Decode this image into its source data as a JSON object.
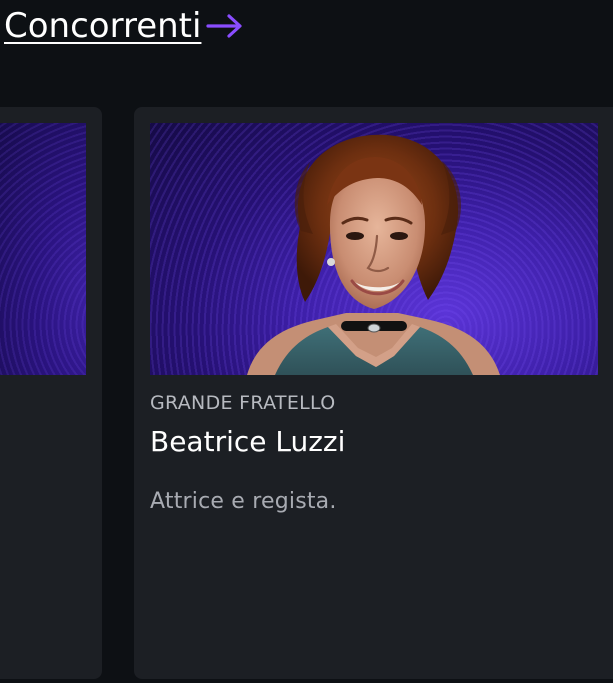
{
  "section": {
    "title": "Concorrenti",
    "arrow_icon": "arrow-right-icon",
    "accent_color": "#8a4dff"
  },
  "cards": [
    {
      "image_icon": "contestant-portrait-image"
    },
    {
      "kicker": "GRANDE FRATELLO",
      "name": "Beatrice Luzzi",
      "description": "Attrice e regista.",
      "image_icon": "contestant-portrait-image"
    }
  ],
  "colors": {
    "background": "#0d1014",
    "card_background": "#1c1f24",
    "thumb_purple": "#3d1fa8"
  }
}
